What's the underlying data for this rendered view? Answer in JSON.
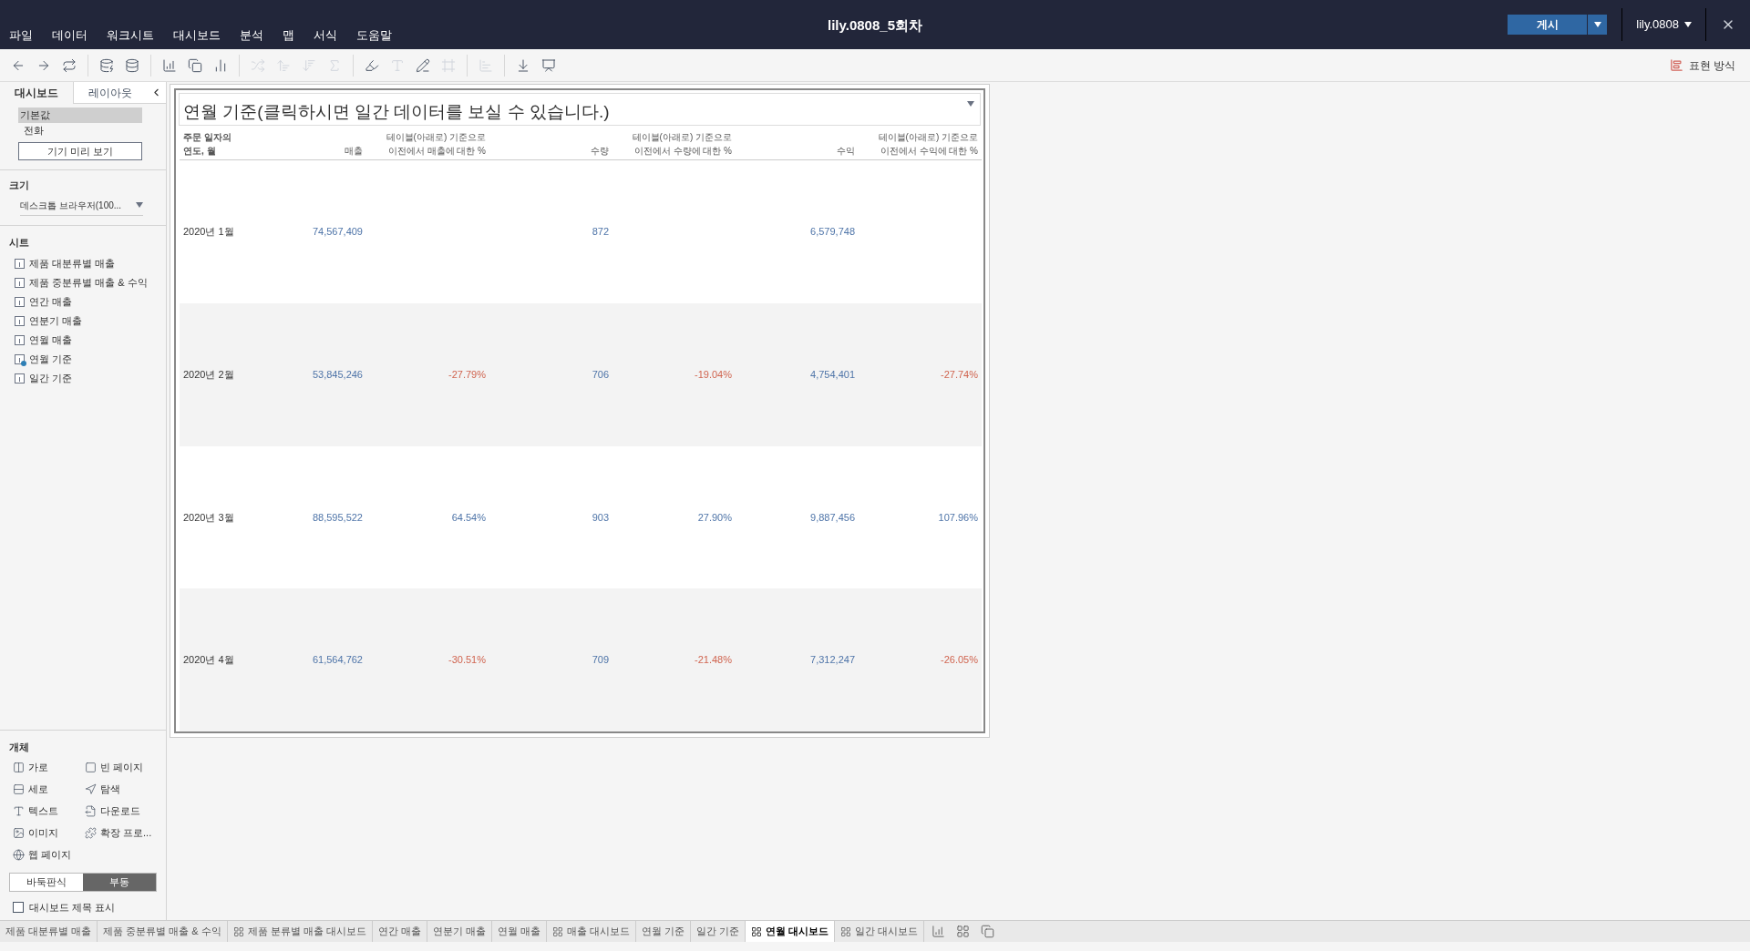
{
  "window": {
    "title": "lily.0808_5회차"
  },
  "menu": [
    "파일",
    "데이터",
    "워크시트",
    "대시보드",
    "분석",
    "맵",
    "서식",
    "도움말"
  ],
  "publish": {
    "label": "게시"
  },
  "user": {
    "name": "lily.0808"
  },
  "show_me": {
    "label": "표현 방식"
  },
  "side_tabs": [
    {
      "label": "대시보드",
      "selected": true
    },
    {
      "label": "레이아웃",
      "selected": false
    }
  ],
  "devices": [
    {
      "label": "기본값",
      "selected": true
    },
    {
      "label": "전화",
      "selected": false
    }
  ],
  "device_preview": {
    "label": "기기 미리 보기"
  },
  "size": {
    "heading": "크기",
    "value": "데스크톱 브라우저(100..."
  },
  "sheets": {
    "heading": "시트",
    "items": [
      {
        "label": "제품 대분류별 매출",
        "used": false
      },
      {
        "label": "제품 중분류별 매출 & 수익",
        "used": false
      },
      {
        "label": "연간 매출",
        "used": false
      },
      {
        "label": "연분기 매출",
        "used": false
      },
      {
        "label": "연월 매출",
        "used": false
      },
      {
        "label": "연월 기준",
        "used": true
      },
      {
        "label": "일간 기준",
        "used": false
      }
    ]
  },
  "objects": {
    "heading": "개체",
    "items": [
      {
        "label": "가로",
        "kind": "horizontal"
      },
      {
        "label": "빈 페이지",
        "kind": "blank"
      },
      {
        "label": "세로",
        "kind": "vertical"
      },
      {
        "label": "탐색",
        "kind": "navigation"
      },
      {
        "label": "텍스트",
        "kind": "text"
      },
      {
        "label": "다운로드",
        "kind": "download"
      },
      {
        "label": "이미지",
        "kind": "image"
      },
      {
        "label": "확장 프로...",
        "kind": "extension"
      },
      {
        "label": "웹 페이지",
        "kind": "web"
      }
    ]
  },
  "layout_mode": [
    {
      "label": "바둑판식",
      "selected": false
    },
    {
      "label": "부동",
      "selected": true
    }
  ],
  "show_title": {
    "label": "대시보드 제목 표시",
    "checked": false
  },
  "view": {
    "title": "연월 기준(클릭하시면 일간 데이터를 보실 수 있습니다.)",
    "columns": [
      "주문 일자의 연도, 월",
      "매출",
      "테이블(아래로) 기준으로 이전에서 매출에 대한 %",
      "수량",
      "테이블(아래로) 기준으로 이전에서 수량에 대한 %",
      "수익",
      "테이블(아래로) 기준으로 이전에서 수익에 대한 %"
    ],
    "rows": [
      {
        "cells": [
          {
            "text": "2020년 1월",
            "kind": "label"
          },
          {
            "text": "74,567,409",
            "negative": false
          },
          null,
          {
            "text": "872",
            "negative": false
          },
          null,
          {
            "text": "6,579,748",
            "negative": false
          },
          null
        ]
      },
      {
        "cells": [
          {
            "text": "2020년 2월",
            "kind": "label"
          },
          {
            "text": "53,845,246",
            "negative": false
          },
          {
            "text": "-27.79%",
            "negative": true
          },
          {
            "text": "706",
            "negative": false
          },
          {
            "text": "-19.04%",
            "negative": true
          },
          {
            "text": "4,754,401",
            "negative": false
          },
          {
            "text": "-27.74%",
            "negative": true
          }
        ]
      },
      {
        "cells": [
          {
            "text": "2020년 3월",
            "kind": "label"
          },
          {
            "text": "88,595,522",
            "negative": false
          },
          {
            "text": "64.54%",
            "negative": false
          },
          {
            "text": "903",
            "negative": false
          },
          {
            "text": "27.90%",
            "negative": false
          },
          {
            "text": "9,887,456",
            "negative": false
          },
          {
            "text": "107.96%",
            "negative": false
          }
        ]
      },
      {
        "cells": [
          {
            "text": "2020년 4월",
            "kind": "label"
          },
          {
            "text": "61,564,762",
            "negative": false
          },
          {
            "text": "-30.51%",
            "negative": true
          },
          {
            "text": "709",
            "negative": false
          },
          {
            "text": "-21.48%",
            "negative": true
          },
          {
            "text": "7,312,247",
            "negative": false
          },
          {
            "text": "-26.05%",
            "negative": true
          }
        ]
      }
    ]
  },
  "tabs": [
    {
      "label": "제품 대분류별 매출",
      "kind": "sheet",
      "selected": false
    },
    {
      "label": "제품 중분류별 매출 & 수익",
      "kind": "sheet",
      "selected": false
    },
    {
      "label": "제품 분류별 매출 대시보드",
      "kind": "dashboard",
      "selected": false
    },
    {
      "label": "연간 매출",
      "kind": "sheet",
      "selected": false
    },
    {
      "label": "연분기 매출",
      "kind": "sheet",
      "selected": false
    },
    {
      "label": "연월 매출",
      "kind": "sheet",
      "selected": false
    },
    {
      "label": "매출 대시보드",
      "kind": "dashboard",
      "selected": false
    },
    {
      "label": "연월 기준",
      "kind": "sheet",
      "selected": false
    },
    {
      "label": "일간 기준",
      "kind": "sheet",
      "selected": false
    },
    {
      "label": "연월 대시보드",
      "kind": "dashboard",
      "selected": true
    },
    {
      "label": "일간 대시보드",
      "kind": "dashboard",
      "selected": false
    }
  ]
}
